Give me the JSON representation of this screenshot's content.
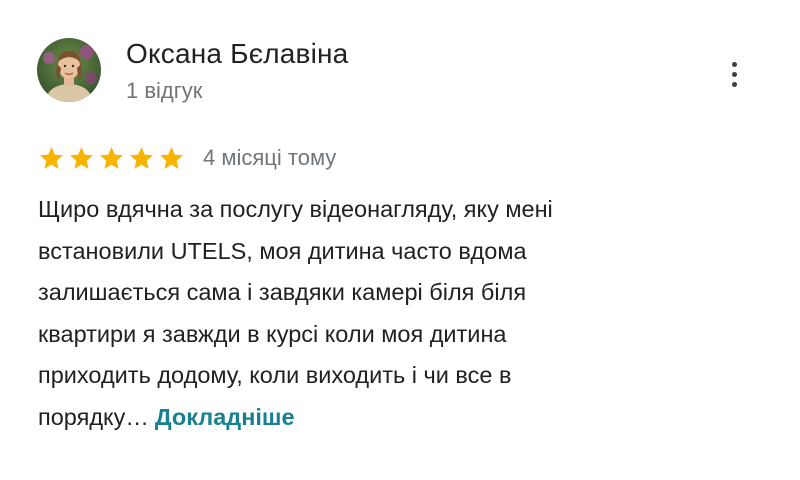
{
  "reviewer": {
    "name": "Оксана Бєлавіна",
    "review_count": "1 відгук",
    "avatar_icon": "reviewer-photo"
  },
  "menu": {
    "icon": "more-vertical-icon"
  },
  "rating": {
    "stars": 5,
    "max_stars": 5,
    "star_color": "#f6b300",
    "date": "4 місяці тому"
  },
  "review": {
    "lines": [
      "Щиро вдячна за послугу відеонагляду, яку мені",
      "встановили UTELS, моя дитина часто вдома",
      "залишається сама і завдяки камері біля біля",
      "квартири я завжди в курсі коли моя дитина",
      "приходить додому, коли виходить і чи все в",
      "порядку…"
    ],
    "read_more_label": "Докладніше",
    "link_color": "#188090"
  }
}
